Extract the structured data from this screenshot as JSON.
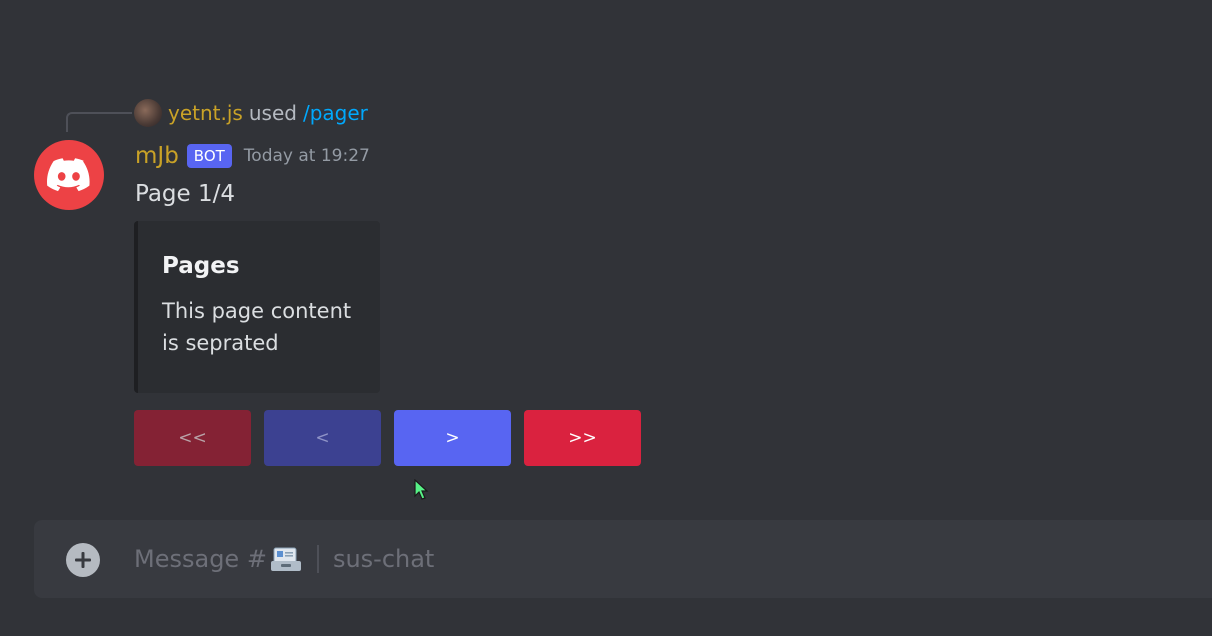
{
  "reply": {
    "username": "yetnt.js",
    "used": "used",
    "command": "/pager"
  },
  "message": {
    "username": "mJb",
    "bot_tag": "BOT",
    "timestamp": "Today at 19:27",
    "content": "Page 1/4"
  },
  "embed": {
    "title": "Pages",
    "description_line1": "This page content",
    "description_line2": "is seprated"
  },
  "buttons": {
    "first_label": "<<",
    "prev_label": "<",
    "next_label": ">",
    "last_label": ">>"
  },
  "input": {
    "prefix": "Message #",
    "channel": "sus-chat"
  },
  "colors": {
    "background": "#313338",
    "blurple": "#5865f2",
    "red": "#da223f",
    "username": "#c9a227",
    "command": "#00a8fc"
  },
  "icons": {
    "avatar": "discord-logo-icon",
    "add": "plus-circle-icon",
    "channel_emoji": "card-file-box-icon",
    "cursor": "mouse-pointer-icon"
  }
}
